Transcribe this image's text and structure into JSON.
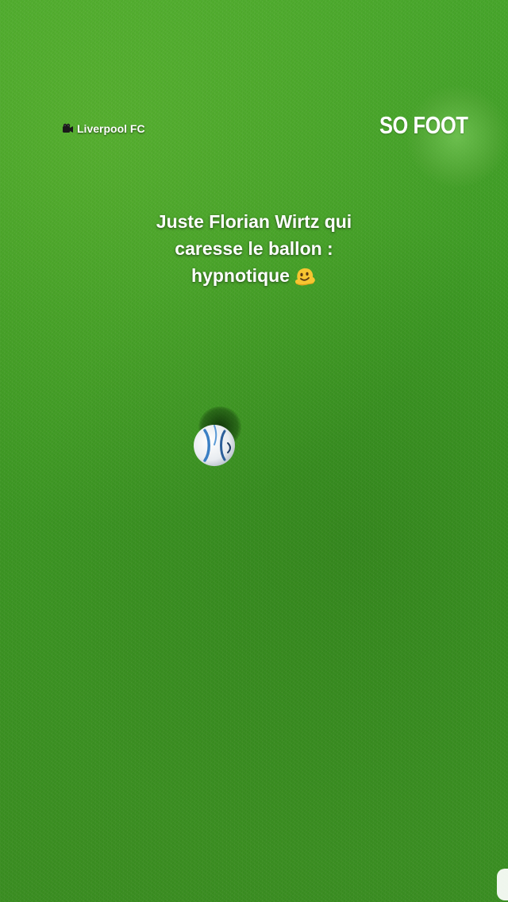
{
  "location": {
    "icon": "camera-icon",
    "label": "Liverpool FC"
  },
  "watermark": {
    "label": "SO FOOT"
  },
  "caption": {
    "lines": [
      "Juste Florian Wirtz qui",
      "caresse le ballon :",
      "hypnotique"
    ],
    "emoji": "melting-face-emoji"
  },
  "scene": {
    "object": "soccer-ball",
    "colors": {
      "grass": "#3d9a24",
      "ball_primary": "#f4f6f8",
      "ball_accent": "#3a7fc4"
    }
  }
}
